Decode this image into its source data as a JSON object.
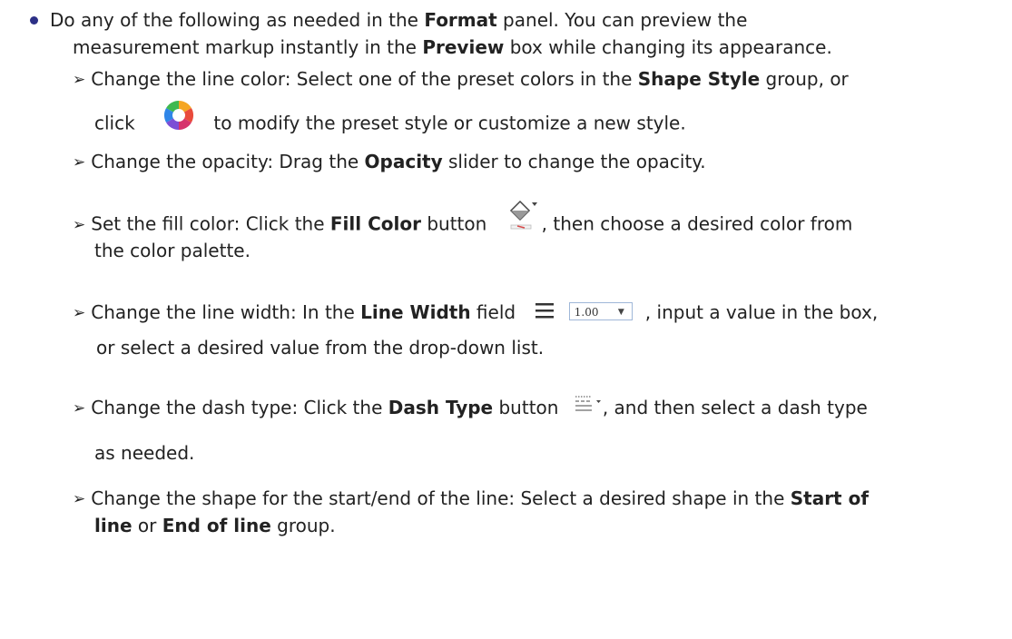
{
  "intro": {
    "line1_pre": "Do any of the following as needed in the ",
    "line1_b": "Format",
    "line1_post": " panel. You can preview the",
    "line2_pre": "measurement markup instantly in the ",
    "line2_b": "Preview",
    "line2_post": " box while changing its appearance."
  },
  "items": [
    {
      "a": "Change the line color: Select one of the preset colors in the ",
      "b": "Shape Style",
      "c": " group, or",
      "d": "click",
      "e": "to modify the preset style or customize a new style."
    },
    {
      "a": "Change the opacity: Drag the ",
      "b": "Opacity",
      "c": " slider to change the opacity."
    },
    {
      "a": "Set the fill color: Click the ",
      "b": "Fill Color",
      "c": " button",
      "d": ", then choose a desired color from",
      "e": "the color palette."
    },
    {
      "a": "Change the line width: In the ",
      "b": "Line Width",
      "c": " field",
      "d": ", input a value in the box,",
      "e": "or select a desired value from the drop-down list."
    },
    {
      "a": "Change the dash type: Click the ",
      "b": "Dash Type",
      "c": " button",
      "d": ", and then select a dash type",
      "e": "as needed."
    },
    {
      "a": "Change the shape for the start/end of the line: Select a desired shape in the ",
      "b": "Start of",
      "c": "line",
      "d": " or ",
      "e": "End of line",
      "f": " group."
    }
  ],
  "line_width_value": "1.00",
  "icons": [
    "bullet-dot-icon",
    "arrow-bullet-icon",
    "color-wheel-icon",
    "fill-color-icon",
    "line-width-icon",
    "dropdown-caret-icon",
    "dash-type-icon"
  ],
  "colors": {
    "bullet": "#2c2f86",
    "field_border": "#9fb7d8",
    "fill_red": "#d94a4a"
  }
}
